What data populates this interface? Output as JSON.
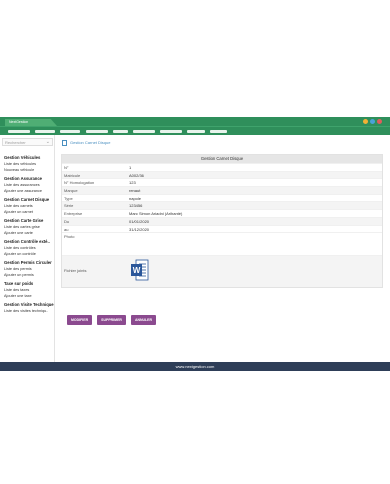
{
  "window": {
    "tab_label": "NextGestion",
    "dot_colors": [
      "#f2b134",
      "#4aa3d9",
      "#e25c5c"
    ]
  },
  "navbar": {
    "item_count": 9
  },
  "sidebar": {
    "search_placeholder": "Rechercher",
    "groups": [
      {
        "title": "Gestion Véhicules",
        "items": [
          "Liste des véhicules",
          "Nouveau véhicule"
        ]
      },
      {
        "title": "Gestion Assurance",
        "items": [
          "Liste des assurances",
          "Ajouter une assurance"
        ]
      },
      {
        "title": "Gestion Carnet Disque",
        "items": [
          "Liste des carnets",
          "Ajouter un carnet"
        ]
      },
      {
        "title": "Gestion Carte Grise",
        "items": [
          "Liste des cartes grise",
          "Ajouter une carte"
        ]
      },
      {
        "title": "Gestion Contrôle exté..",
        "items": [
          "Liste des contrôles",
          "Ajouter un contrôle"
        ]
      },
      {
        "title": "Gestion Permis Circuler",
        "items": [
          "Liste des permis",
          "Ajouter un permis"
        ]
      },
      {
        "title": "Taxe sur poids",
        "items": [
          "Liste des taxes",
          "Ajouter une taxe"
        ]
      },
      {
        "title": "Gestion Visite Technique",
        "items": [
          "Liste des visites techniqu.."
        ]
      }
    ]
  },
  "main": {
    "breadcrumb": "Gestion Carnet Disque",
    "card_title": "Gestion Carnet Disque",
    "rows": [
      {
        "label": "N°",
        "value": "1"
      },
      {
        "label": "Matricule",
        "value": "A002/36"
      },
      {
        "label": "N° Homologation",
        "value": "123"
      },
      {
        "label": "Marque",
        "value": "renaut"
      },
      {
        "label": "Type",
        "value": "napole"
      },
      {
        "label": "Série",
        "value": "123456"
      },
      {
        "label": "Entreprise",
        "value": "Marc Simon Ariadni (Arihanté)"
      },
      {
        "label": "Du",
        "value": "01/01/2020"
      },
      {
        "label": "au",
        "value": "31/12/2020"
      }
    ],
    "photo_label": "Photo",
    "file_label": "Fichier joints",
    "buttons": {
      "modify": "MODIFIER",
      "delete": "SUPPRIMER",
      "cancel": "ANNULER"
    },
    "accent": "#8b4a8f"
  },
  "footer": {
    "text": "www.nextgestion.com"
  }
}
